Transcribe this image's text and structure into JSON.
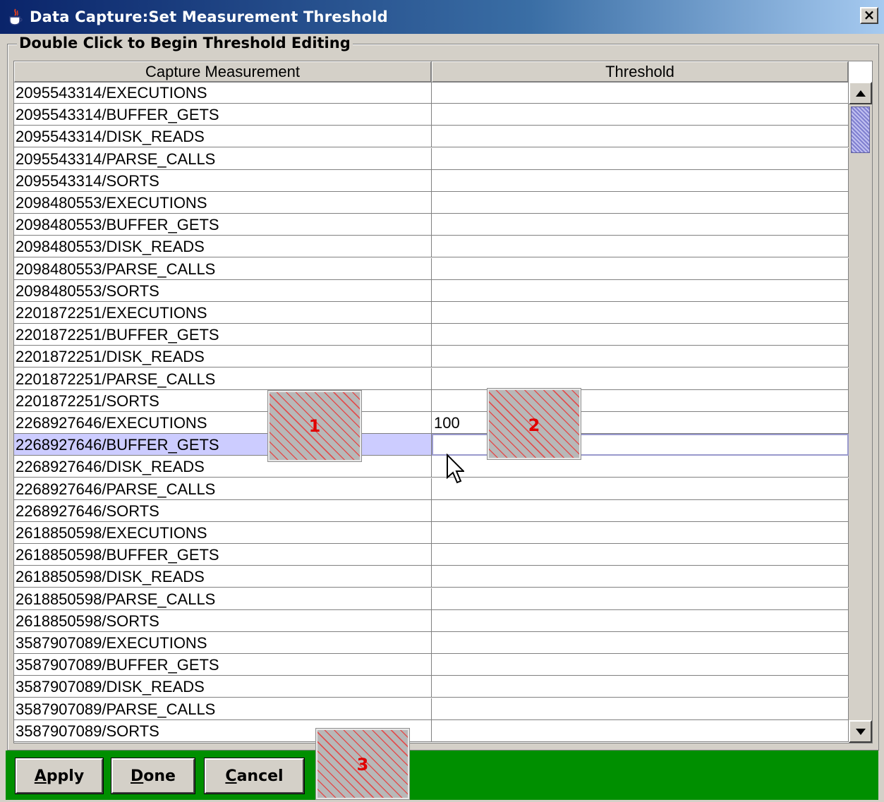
{
  "window": {
    "title": "Data Capture:Set Measurement Threshold",
    "close_glyph": "×",
    "icon": "java-cup-icon"
  },
  "group": {
    "legend": "Double Click to Begin Threshold Editing"
  },
  "table": {
    "columns": [
      "Capture Measurement",
      "Threshold"
    ],
    "rows": [
      {
        "measurement": "2095543314/EXECUTIONS",
        "threshold": ""
      },
      {
        "measurement": "2095543314/BUFFER_GETS",
        "threshold": ""
      },
      {
        "measurement": "2095543314/DISK_READS",
        "threshold": ""
      },
      {
        "measurement": "2095543314/PARSE_CALLS",
        "threshold": ""
      },
      {
        "measurement": "2095543314/SORTS",
        "threshold": ""
      },
      {
        "measurement": "2098480553/EXECUTIONS",
        "threshold": ""
      },
      {
        "measurement": "2098480553/BUFFER_GETS",
        "threshold": ""
      },
      {
        "measurement": "2098480553/DISK_READS",
        "threshold": ""
      },
      {
        "measurement": "2098480553/PARSE_CALLS",
        "threshold": ""
      },
      {
        "measurement": "2098480553/SORTS",
        "threshold": ""
      },
      {
        "measurement": "2201872251/EXECUTIONS",
        "threshold": ""
      },
      {
        "measurement": "2201872251/BUFFER_GETS",
        "threshold": ""
      },
      {
        "measurement": "2201872251/DISK_READS",
        "threshold": ""
      },
      {
        "measurement": "2201872251/PARSE_CALLS",
        "threshold": ""
      },
      {
        "measurement": "2201872251/SORTS",
        "threshold": ""
      },
      {
        "measurement": "2268927646/EXECUTIONS",
        "threshold": "100"
      },
      {
        "measurement": "2268927646/BUFFER_GETS",
        "threshold": "",
        "selected": true
      },
      {
        "measurement": "2268927646/DISK_READS",
        "threshold": ""
      },
      {
        "measurement": "2268927646/PARSE_CALLS",
        "threshold": ""
      },
      {
        "measurement": "2268927646/SORTS",
        "threshold": ""
      },
      {
        "measurement": "2618850598/EXECUTIONS",
        "threshold": ""
      },
      {
        "measurement": "2618850598/BUFFER_GETS",
        "threshold": ""
      },
      {
        "measurement": "2618850598/DISK_READS",
        "threshold": ""
      },
      {
        "measurement": "2618850598/PARSE_CALLS",
        "threshold": ""
      },
      {
        "measurement": "2618850598/SORTS",
        "threshold": ""
      },
      {
        "measurement": "3587907089/EXECUTIONS",
        "threshold": ""
      },
      {
        "measurement": "3587907089/BUFFER_GETS",
        "threshold": ""
      },
      {
        "measurement": "3587907089/DISK_READS",
        "threshold": ""
      },
      {
        "measurement": "3587907089/PARSE_CALLS",
        "threshold": ""
      },
      {
        "measurement": "3587907089/SORTS",
        "threshold": ""
      }
    ]
  },
  "buttons": [
    {
      "label": "Apply",
      "mnemonic": "A",
      "rest": "pply"
    },
    {
      "label": "Done",
      "mnemonic": "D",
      "rest": "one"
    },
    {
      "label": "Cancel",
      "mnemonic": "C",
      "rest": "ancel"
    }
  ],
  "callouts": [
    "1",
    "2",
    "3"
  ],
  "colors": {
    "bottom_bar": "#008f00",
    "selection": "#ccccff",
    "title_bar": "#0a246a"
  }
}
